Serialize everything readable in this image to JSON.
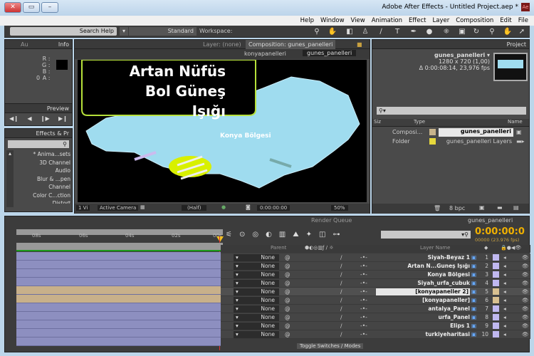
{
  "window": {
    "title": "Adobe After Effects - Untitled Project.aep *",
    "app_icon": "Ae",
    "controls": [
      "close",
      "maximize",
      "minimize"
    ]
  },
  "menu": [
    "File",
    "Edit",
    "Composition",
    "Layer",
    "Effect",
    "Animation",
    "View",
    "Window",
    "Help"
  ],
  "toolbar": {
    "workspace_label": "Workspace:",
    "workspace_value": "Standard",
    "search_placeholder": "Search Help"
  },
  "info_panel": {
    "tab": "Info",
    "tab2": "Au",
    "r": "R :",
    "g": "G :",
    "b": "B :",
    "a": "A :",
    "a_value": "0"
  },
  "preview_panel": {
    "tab": "Preview"
  },
  "effects_panel": {
    "tab": "Effects & Pr",
    "items": [
      "* Anima...sets",
      "3D Channel",
      "Audio",
      "Blur & ...pen",
      "Channel",
      "Color C...ction",
      "Distort"
    ]
  },
  "composition": {
    "tab": "Composition: gunes_panelleri",
    "layer_tab": "Layer: (none)",
    "breadcrumb": [
      "gunes_panelleri",
      "konyapanelleri"
    ],
    "overlay_line1": "Artan Nüfüs",
    "overlay_line2": "Bol Güneş Işığı",
    "map_label": "Konya Bölgesi",
    "zoom": "50%",
    "timecode": "0:00:00:00",
    "resolution": "(Half)",
    "camera": "Active Camera",
    "views": "1 Vi"
  },
  "project": {
    "tab": "Project",
    "comp_name": "gunes_panelleri ▾",
    "comp_size": "1280 x 720 (1,00)",
    "comp_duration": "Δ 0:00:08:14, 23,976 fps",
    "columns": [
      "Name",
      "Type",
      "Siz"
    ],
    "items": [
      {
        "name": "gunes_panelleri",
        "type": "Composi...",
        "color": "#c8b48c"
      },
      {
        "name": "gunes_panelleri Layers",
        "type": "Folder",
        "color": "#e6d83c"
      }
    ],
    "bpc": "8 bpc"
  },
  "timeline": {
    "tab": "gunes_panelleri",
    "render_tab": "Render Queue",
    "timecode": "0:00:00:0",
    "frames": "00000 (23.976 fps)",
    "ticks": [
      "08s",
      "06s",
      "04s",
      "02s",
      "00s"
    ],
    "col_layer_name": "Layer Name",
    "col_parent": "Parent",
    "toggle_label": "Toggle Switches / Modes",
    "layers": [
      {
        "n": "1",
        "name": "Siyah-Beyaz 1",
        "parent": "None",
        "color": "#c0b8f0"
      },
      {
        "n": "2",
        "name": "Artan N...Guneş Işığı",
        "parent": "None",
        "color": "#c0b8f0"
      },
      {
        "n": "3",
        "name": "Konya Bölgesi",
        "parent": "None",
        "color": "#c0b8f0"
      },
      {
        "n": "4",
        "name": "Siyah_urfa_cubuk",
        "parent": "None",
        "color": "#c0b8f0"
      },
      {
        "n": "5",
        "name": "[konyapaneller 2]",
        "parent": "None",
        "color": "#d8c090"
      },
      {
        "n": "6",
        "name": "[konyapaneller]",
        "parent": "None",
        "color": "#d8c090"
      },
      {
        "n": "7",
        "name": "antalya_Panel",
        "parent": "None",
        "color": "#c0b8f0"
      },
      {
        "n": "8",
        "name": "urfa_Panel",
        "parent": "None",
        "color": "#c0b8f0"
      },
      {
        "n": "9",
        "name": "Elips 1",
        "parent": "None",
        "color": "#c0b8f0"
      },
      {
        "n": "10",
        "name": "turkiyeharitasi",
        "parent": "None",
        "color": "#c0b8f0"
      }
    ]
  }
}
